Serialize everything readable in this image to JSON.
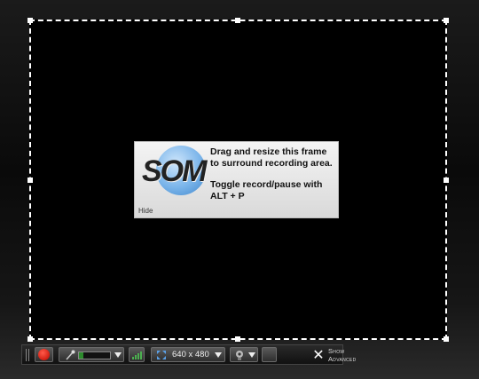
{
  "info_box": {
    "logo_text": "SOM",
    "line1": "Drag and resize this frame to surround recording area.",
    "line2": "Toggle record/pause with ALT + P",
    "hide_label": "Hide"
  },
  "toolbar": {
    "record_icon": "record-icon",
    "mic_icon": "microphone-icon",
    "mic_level": 0.15,
    "signal_icon": "signal-icon",
    "size_icon": "resize-icon",
    "size_value": "640 x 480",
    "webcam_icon": "webcam-icon",
    "close_label": "✕",
    "advanced_line1": "Show",
    "advanced_line2": "Advanced"
  },
  "colors": {
    "record": "#d01e12",
    "logo_blue": "#3f86cc",
    "level_green": "#2c8a2c"
  }
}
